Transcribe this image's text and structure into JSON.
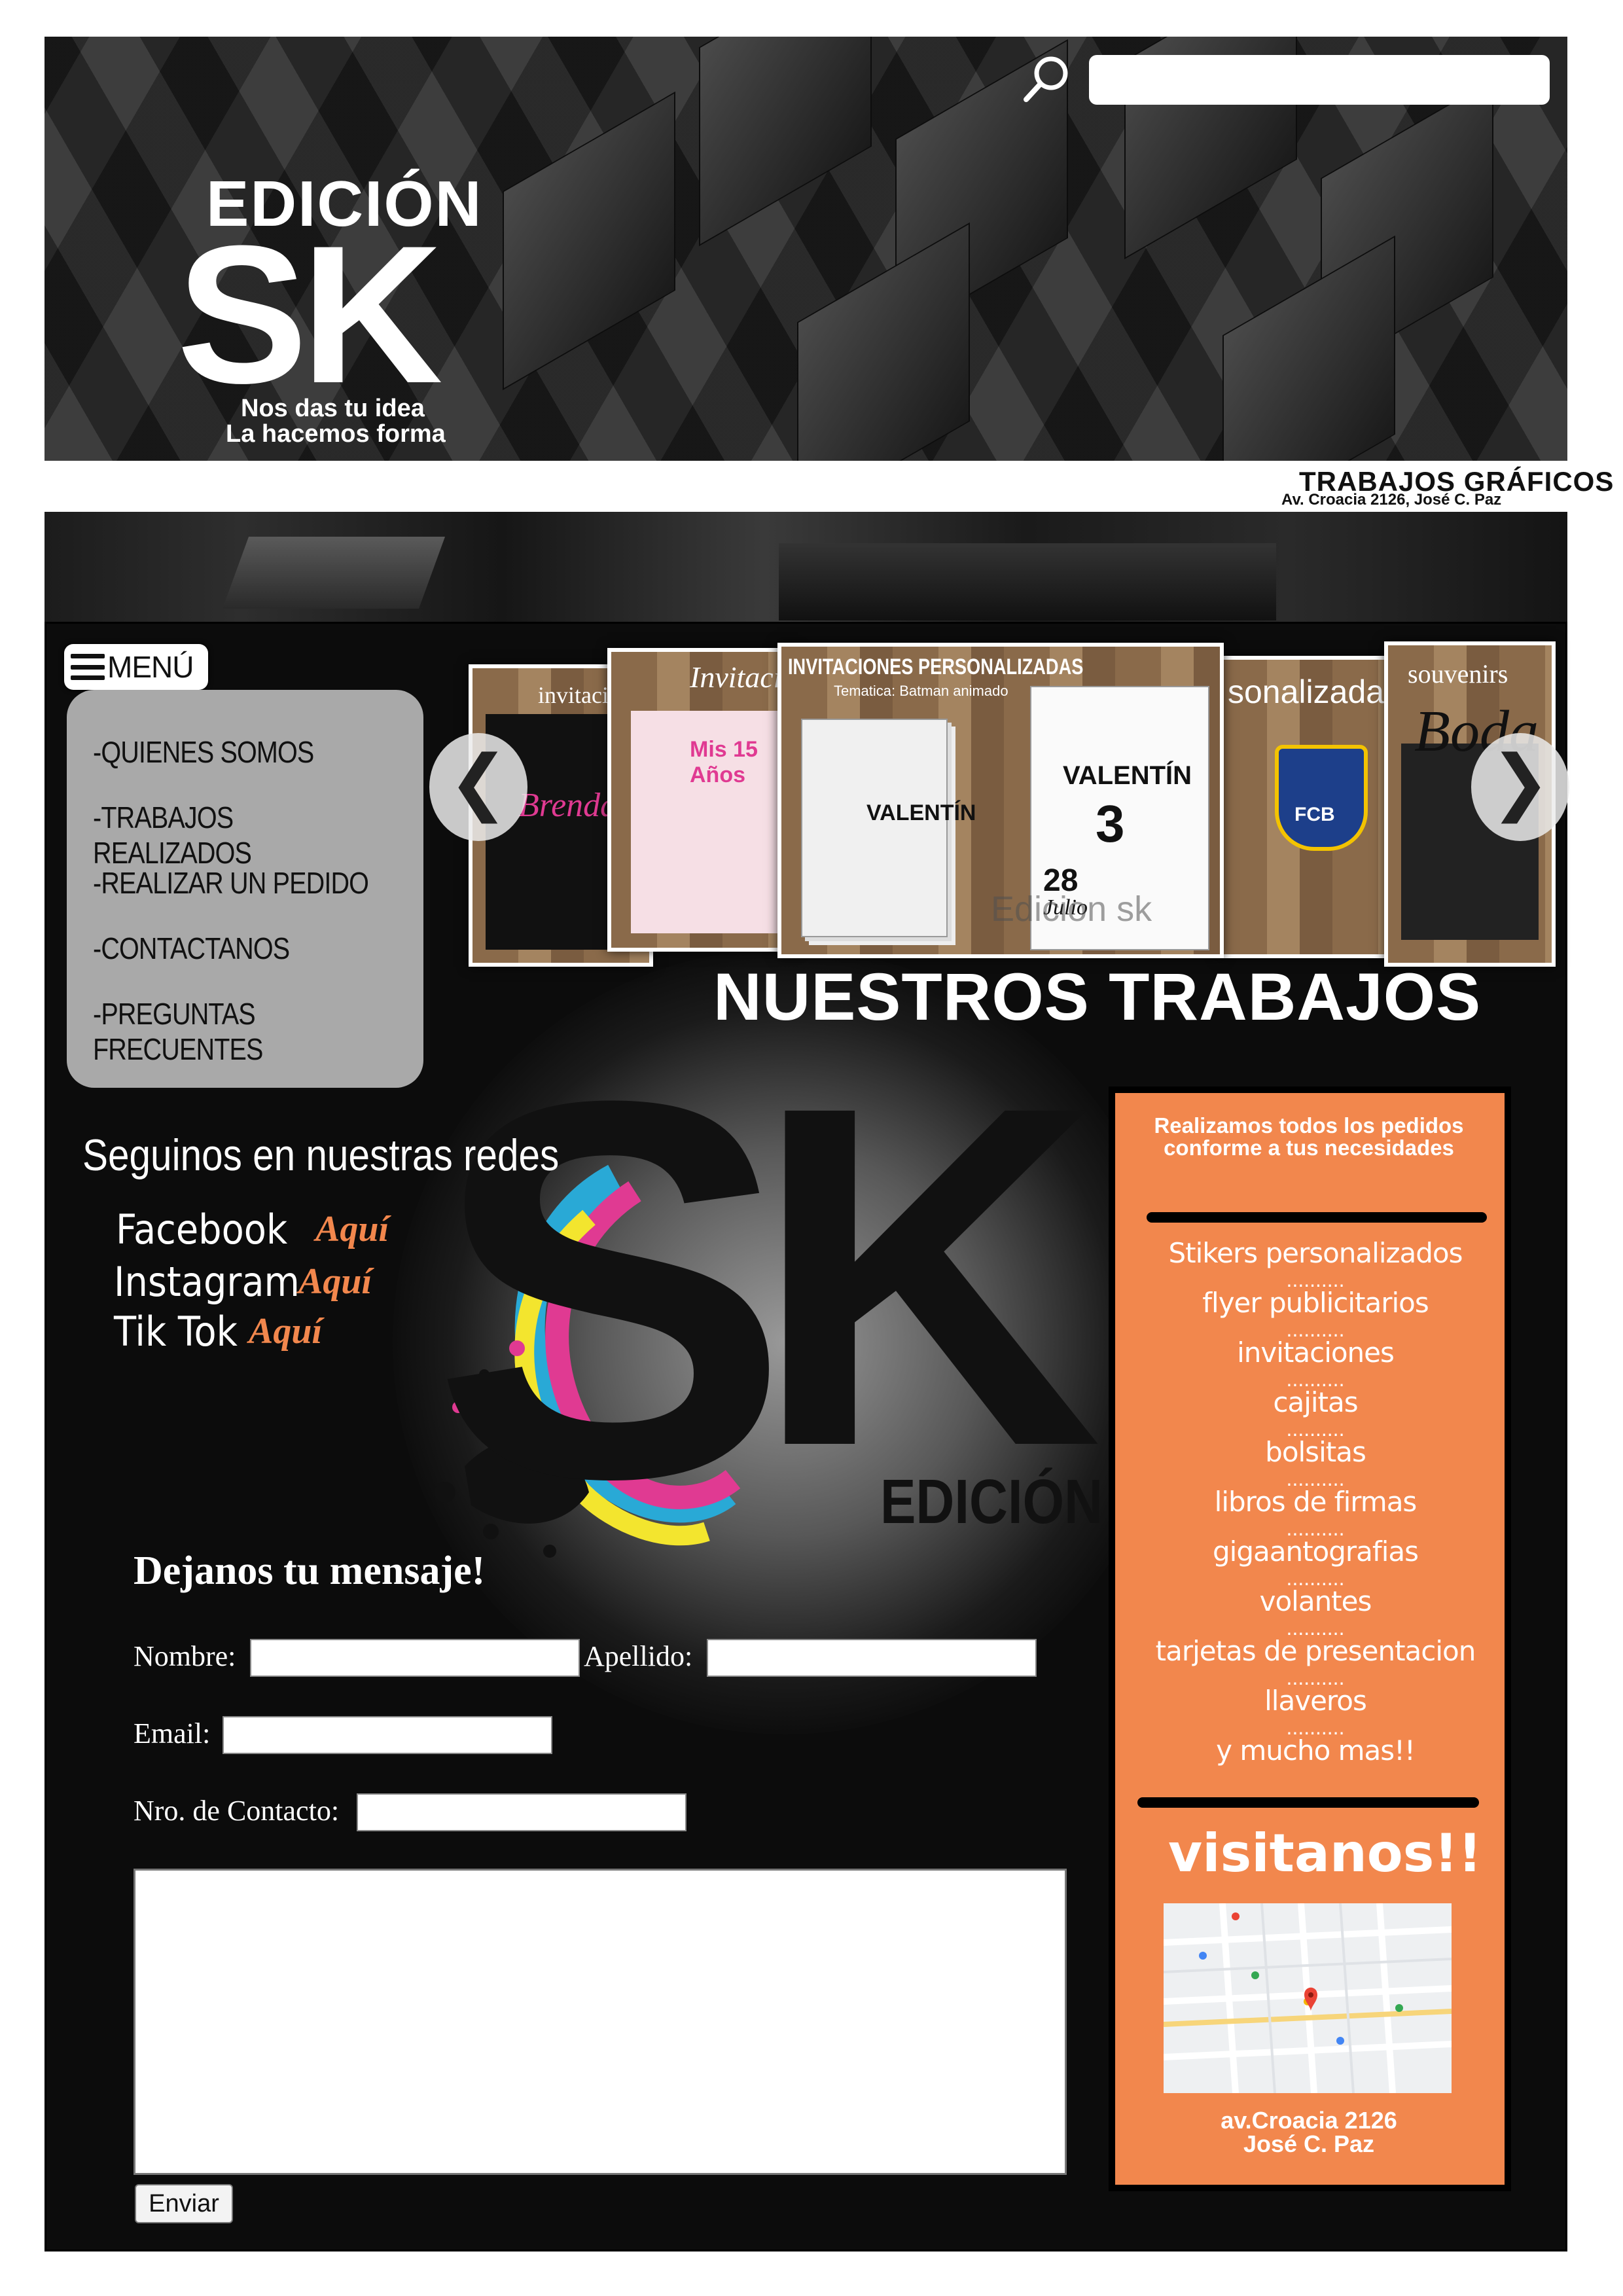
{
  "header": {
    "logo_top": "EDICIÓN",
    "logo_main": "SK",
    "tagline_1": "Nos das tu idea",
    "tagline_2": "La hacemos forma",
    "search_placeholder": "",
    "right_title": "TRABAJOS GRÁFICOS",
    "right_address": "Av. Croacia 2126, José C. Paz"
  },
  "menu": {
    "button_label": "MENÚ",
    "items": [
      "-QUIENES SOMOS",
      "-TRABAJOS REALIZADOS",
      "-REALIZAR UN PEDIDO",
      "-CONTACTANOS",
      "-PREGUNTAS FRECUENTES"
    ]
  },
  "carousel": {
    "prev_icon": "❮",
    "next_icon": "❯",
    "cards": [
      {
        "title": "invitaci",
        "text": "Brenda"
      },
      {
        "title": "Invitacio",
        "text": "Mis 15 Años"
      },
      {
        "title": "INVITACIONES PERSONALIZADAS",
        "subtitle": "Tematica: Batman animado",
        "name": "VALENTÍN",
        "age": "3",
        "date": "28",
        "month": "Julio",
        "watermark": "Edicion sk"
      },
      {
        "title": "sonalizadas",
        "text": "FCB"
      },
      {
        "title": "souvenirs",
        "text": "Boda"
      }
    ],
    "section_title": "NUESTROS TRABAJOS"
  },
  "big_logo": {
    "s": "S",
    "k": "K",
    "edicion": "EDICIÓN"
  },
  "social": {
    "heading": "Seguinos en nuestras redes",
    "items": [
      {
        "name": "Facebook",
        "link": "Aquí"
      },
      {
        "name": "Instagram",
        "link": "Aquí"
      },
      {
        "name": "Tik Tok",
        "link": "Aquí"
      }
    ]
  },
  "form": {
    "title": "Dejanos tu mensaje!",
    "nombre_label": "Nombre:",
    "apellido_label": "Apellido:",
    "email_label": "Email:",
    "contacto_label": "Nro. de Contacto:",
    "submit_label": "Enviar"
  },
  "services": {
    "heading": "Realizamos todos los pedidos conforme a tus necesidades",
    "items": [
      "Stikers personalizados",
      "flyer publicitarios",
      "invitaciones",
      "cajitas",
      "bolsitas",
      "libros de firmas",
      "gigaantografias",
      "volantes",
      "tarjetas de presentacion",
      "llaveros",
      "y mucho mas!!"
    ],
    "separator": "..........",
    "visit_label": "visitanos!!",
    "address_line1": "av.Croacia 2126",
    "address_line2": "José C. Paz"
  },
  "colors": {
    "accent_orange": "#f2874d",
    "dark_bg": "#0c0c0c",
    "menu_panel": "#a9a9a9"
  }
}
